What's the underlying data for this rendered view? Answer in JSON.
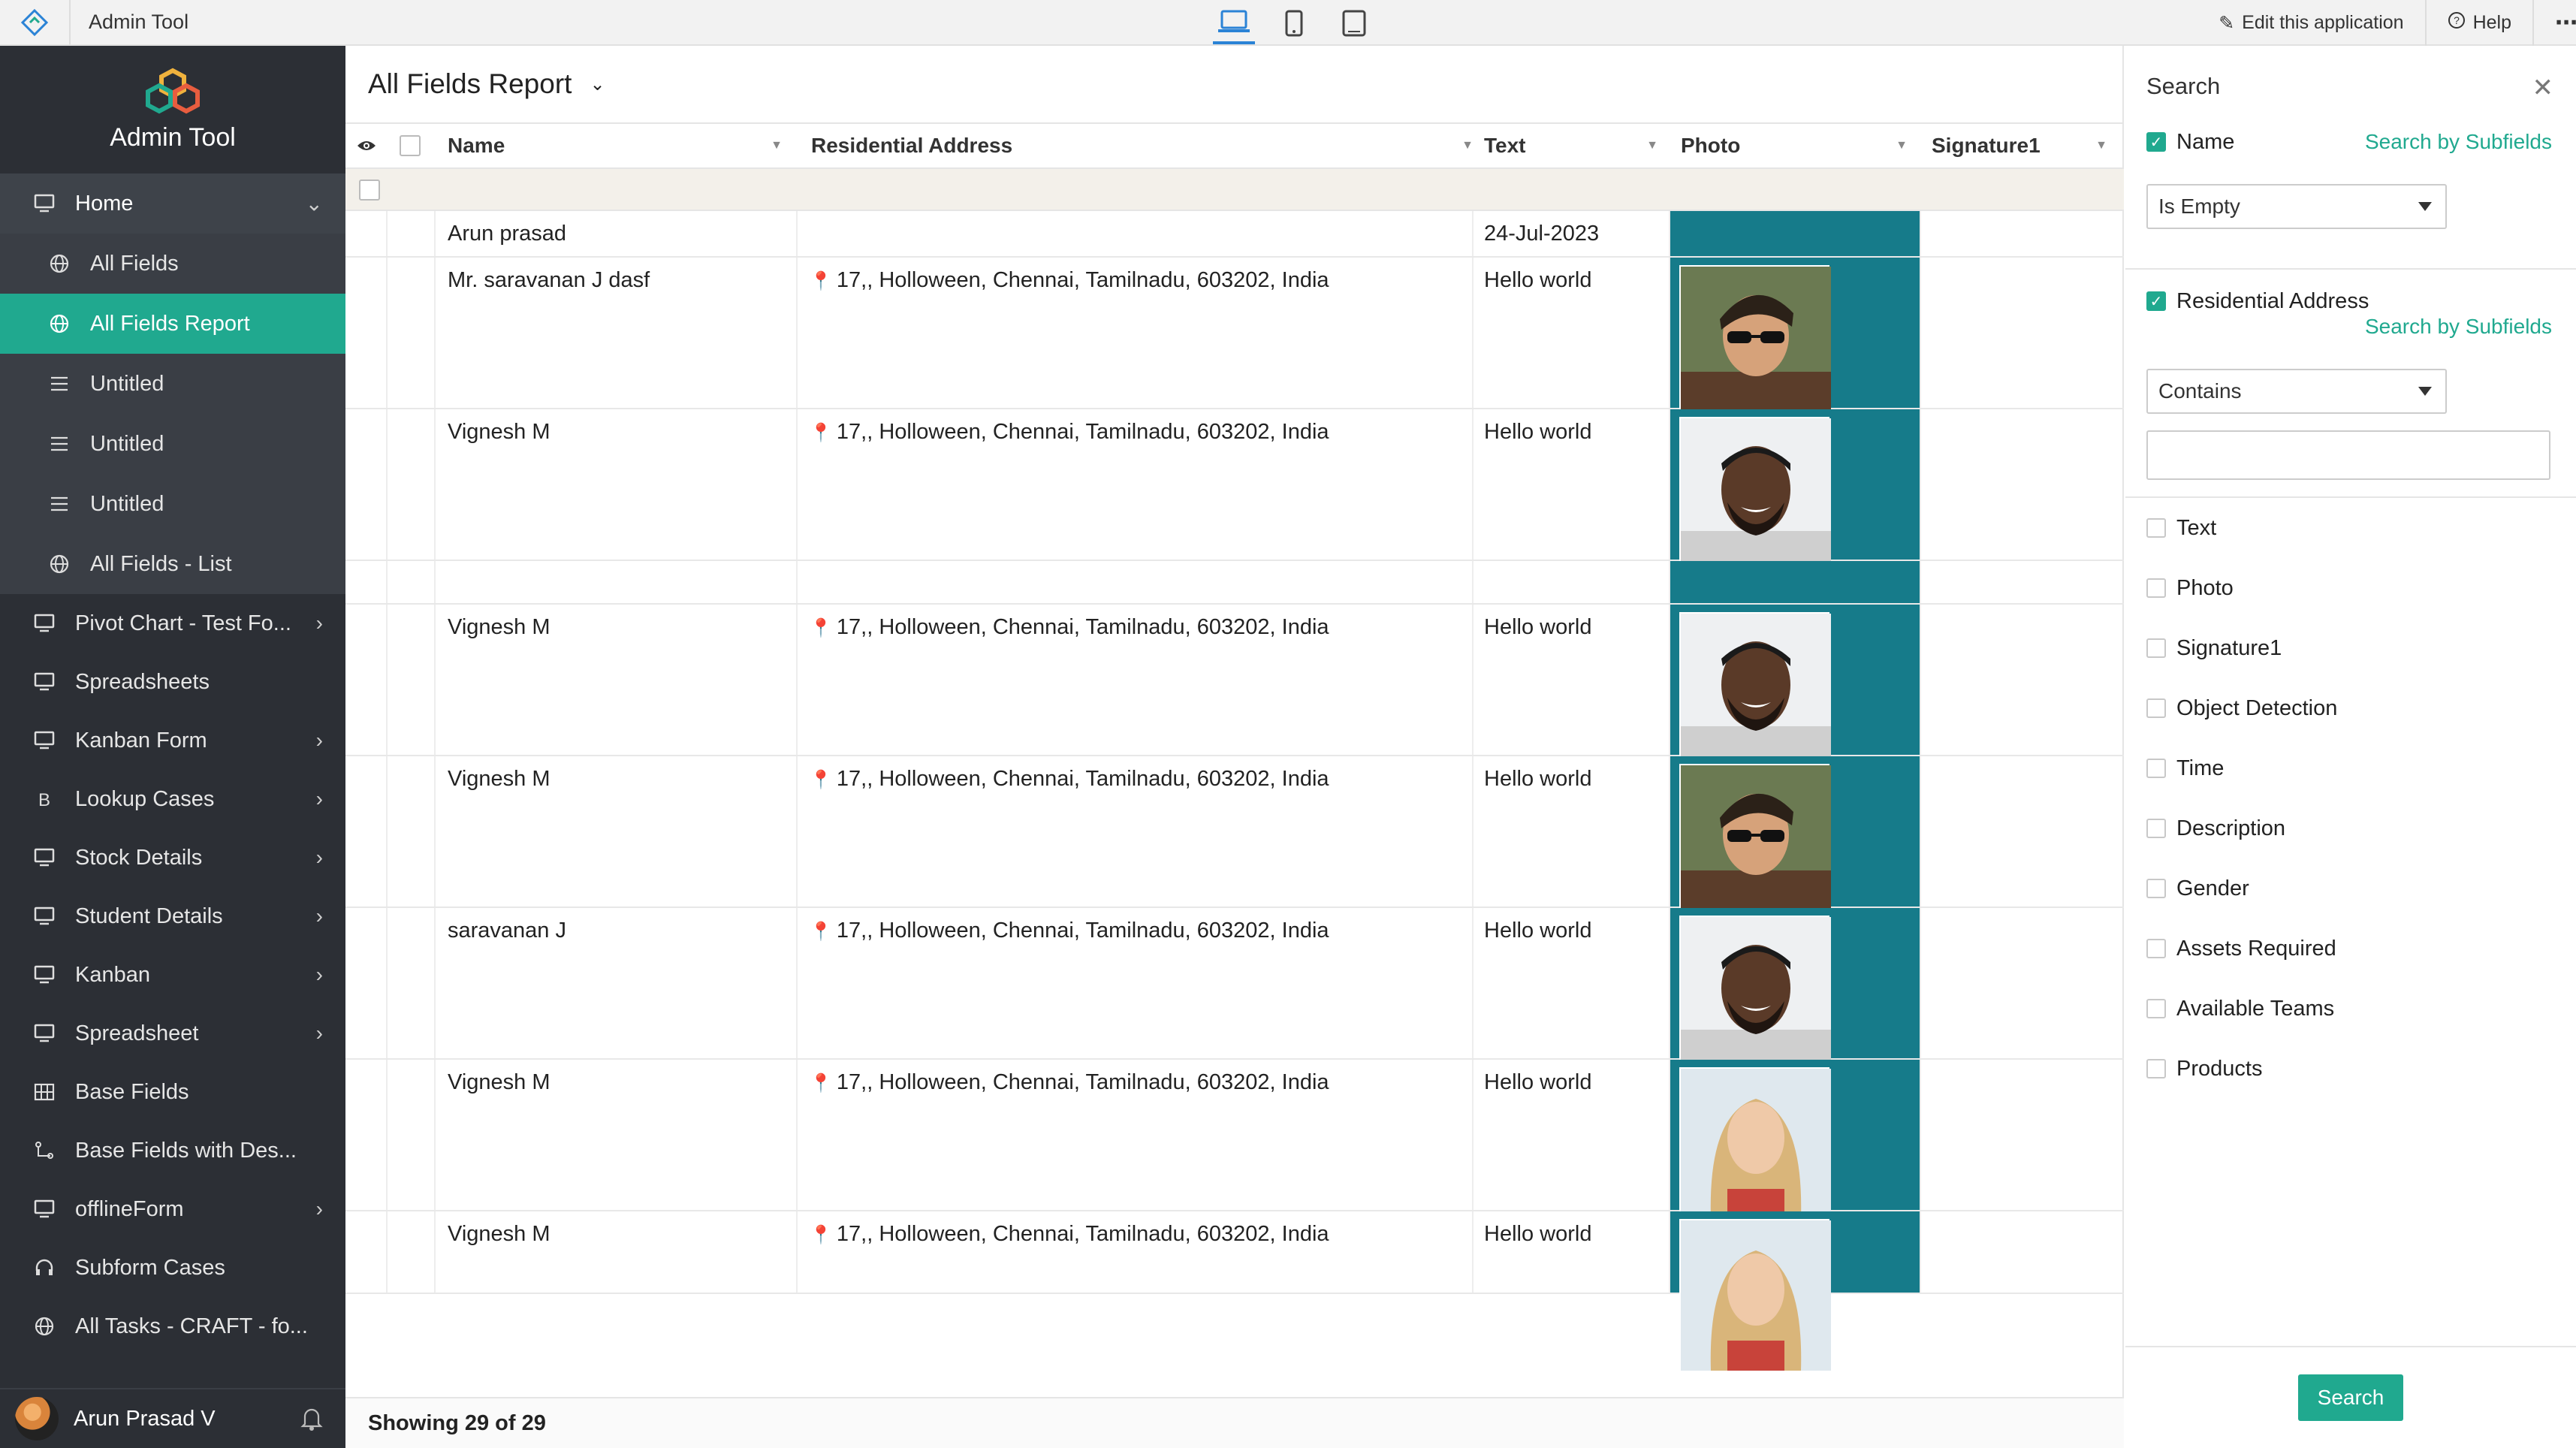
{
  "topbar": {
    "app_title": "Admin Tool",
    "edit_label": "Edit this application",
    "help_label": "Help"
  },
  "sidebar": {
    "brand_name": "Admin Tool",
    "home_label": "Home",
    "sub_items": [
      {
        "label": "All Fields",
        "icon": "globe-icon"
      },
      {
        "label": "All Fields Report",
        "icon": "globe-icon"
      },
      {
        "label": "Untitled",
        "icon": "list-icon"
      },
      {
        "label": "Untitled",
        "icon": "list-icon"
      },
      {
        "label": "Untitled",
        "icon": "list-icon"
      },
      {
        "label": "All Fields - List",
        "icon": "globe-icon"
      }
    ],
    "items": [
      {
        "label": "Pivot Chart - Test Fo...",
        "chev": true
      },
      {
        "label": "Spreadsheets",
        "chev": false
      },
      {
        "label": "Kanban Form",
        "chev": true
      },
      {
        "label": "Lookup Cases",
        "chev": true
      },
      {
        "label": "Stock Details",
        "chev": true
      },
      {
        "label": "Student Details",
        "chev": true
      },
      {
        "label": "Kanban",
        "chev": true
      },
      {
        "label": "Spreadsheet",
        "chev": true
      },
      {
        "label": "Base Fields",
        "chev": false
      },
      {
        "label": "Base Fields with Des...",
        "chev": false
      },
      {
        "label": "offlineForm",
        "chev": true
      },
      {
        "label": "Subform Cases",
        "chev": false
      },
      {
        "label": "All Tasks - CRAFT - fo...",
        "chev": false
      }
    ],
    "user_name": "Arun Prasad V"
  },
  "report": {
    "title": "All Fields Report",
    "columns": {
      "name": "Name",
      "address": "Residential Address",
      "text": "Text",
      "photo": "Photo",
      "signature": "Signature1"
    },
    "rows": [
      {
        "name": "Arun prasad",
        "address": "",
        "text": "24-Jul-2023",
        "photo": "none"
      },
      {
        "name": "Mr. saravanan J dasf",
        "address": "17,, Holloween, Chennai, Tamilnadu, 603202, India",
        "text": "Hello world",
        "photo": "man-sunglasses"
      },
      {
        "name": "Vignesh M",
        "address": "17,, Holloween, Chennai, Tamilnadu, 603202, India",
        "text": "Hello world",
        "photo": "man-smiling"
      },
      {
        "name": "",
        "address": "",
        "text": "",
        "photo": "none"
      },
      {
        "name": "Vignesh M",
        "address": "17,, Holloween, Chennai, Tamilnadu, 603202, India",
        "text": "Hello world",
        "photo": "man-smiling"
      },
      {
        "name": "Vignesh M",
        "address": "17,, Holloween, Chennai, Tamilnadu, 603202, India",
        "text": "Hello world",
        "photo": "man-sunglasses"
      },
      {
        "name": "saravanan J",
        "address": "17,, Holloween, Chennai, Tamilnadu, 603202, India",
        "text": "Hello world",
        "photo": "man-smiling"
      },
      {
        "name": "Vignesh M",
        "address": "17,, Holloween, Chennai, Tamilnadu, 603202, India",
        "text": "Hello world",
        "photo": "woman-blonde"
      },
      {
        "name": "Vignesh M",
        "address": "17,, Holloween, Chennai, Tamilnadu, 603202, India",
        "text": "Hello world",
        "photo": "woman-blonde"
      }
    ],
    "footer": "Showing 29 of 29"
  },
  "search_panel": {
    "title": "Search",
    "name_label": "Name",
    "name_link": "Search by Subfields",
    "name_operator": "Is Empty",
    "address_label": "Residential Address",
    "address_link": "Search by Subfields",
    "address_operator": "Contains",
    "address_value": "",
    "fields": [
      "Text",
      "Photo",
      "Signature1",
      "Object Detection",
      "Time",
      "Description",
      "Gender",
      "Assets Required",
      "Available Teams",
      "Products"
    ],
    "search_button": "Search"
  },
  "colors": {
    "accent": "#20a98f",
    "sidebar_bg": "#2c2f35",
    "photo_cell": "#167b8a"
  }
}
